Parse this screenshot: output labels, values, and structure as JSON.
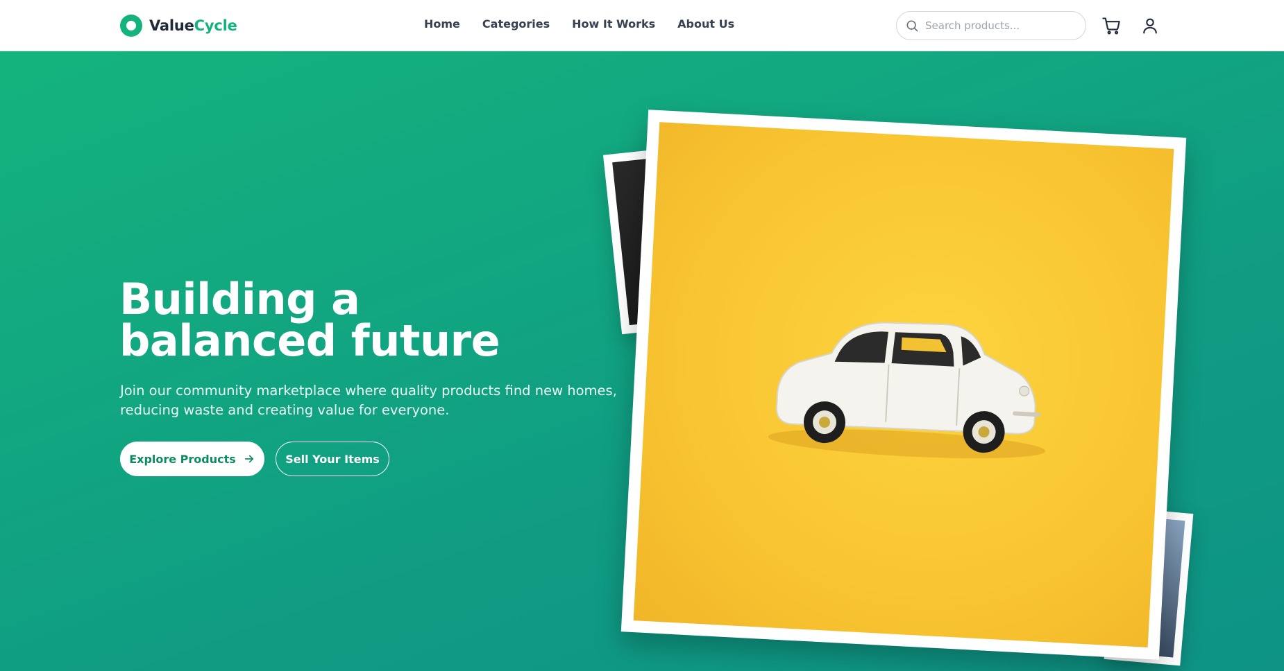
{
  "brand": {
    "name_part1": "Value",
    "name_part2": "Cycle",
    "accent": "#14b37d"
  },
  "nav": {
    "items": [
      {
        "label": "Home"
      },
      {
        "label": "Categories"
      },
      {
        "label": "How It Works"
      },
      {
        "label": "About Us"
      }
    ]
  },
  "search": {
    "placeholder": "Search products...",
    "value": "",
    "icon": "search-icon"
  },
  "header_icons": {
    "cart": "cart-icon",
    "user": "user-icon"
  },
  "hero": {
    "title": "Building a balanced future",
    "subtitle": "Join our community marketplace where quality products find new homes, reducing waste and creating value for everyone.",
    "primary_cta": "Explore Products",
    "primary_cta_icon": "arrow-right-icon",
    "secondary_cta": "Sell Your Items",
    "background_colors": [
      "#14b37d",
      "#0e9385"
    ]
  }
}
